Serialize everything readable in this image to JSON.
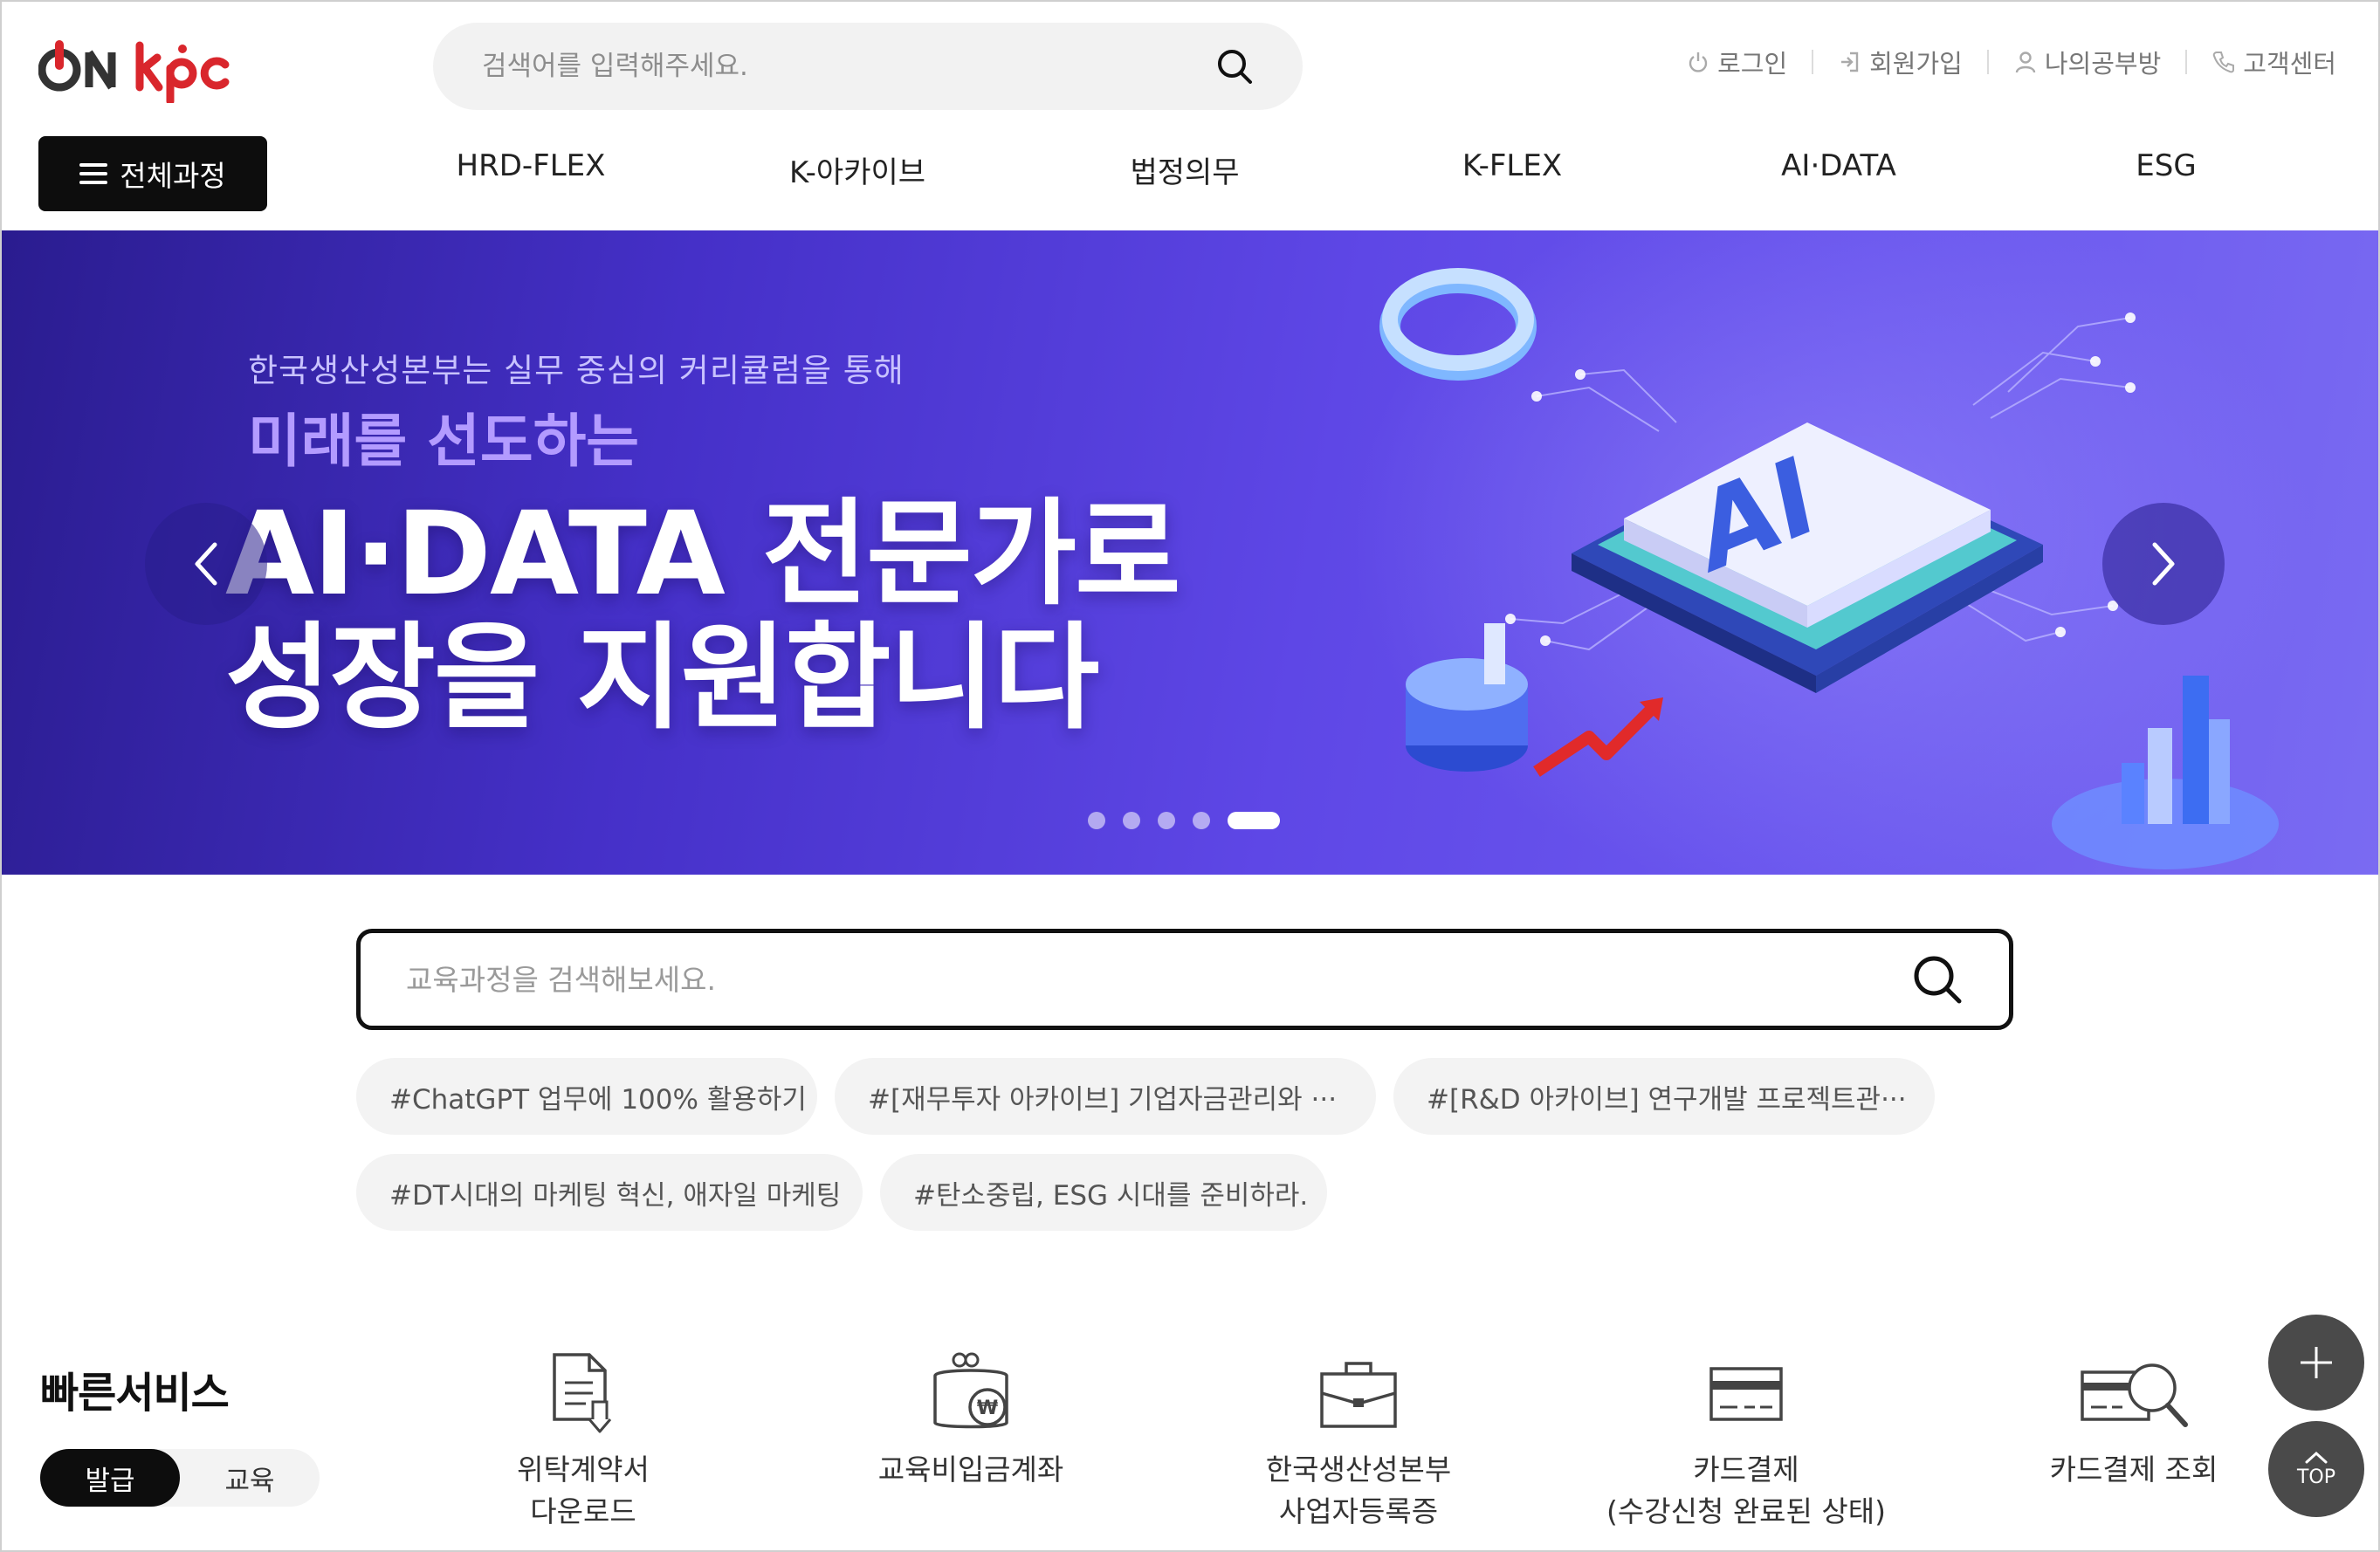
{
  "logo": {
    "alt": "ON kpc"
  },
  "header": {
    "search_placeholder": "검색어를 입력해주세요.",
    "util": [
      {
        "label": "로그인",
        "icon": "power-icon"
      },
      {
        "label": "회원가입",
        "icon": "signin-icon"
      },
      {
        "label": "나의공부방",
        "icon": "user-icon"
      },
      {
        "label": "고객센터",
        "icon": "phone-icon"
      }
    ]
  },
  "nav": {
    "all_courses": "전체과정",
    "items": [
      "HRD-FLEX",
      "K-아카이브",
      "법정의무",
      "K-FLEX",
      "AI·DATA",
      "ESG"
    ]
  },
  "banner": {
    "subtitle": "한국생산성본부는 실무 중심의 커리큘럼을 통해",
    "headline_small": "미래를 선도하는",
    "headline_line1": "AI·DATA 전문가로",
    "headline_line2": "성장을 지원합니다",
    "slide_count": 5,
    "active_slide": 5,
    "chip_text": "AI"
  },
  "main_search": {
    "placeholder": "교육과정을 검색해보세요."
  },
  "tags": [
    "#ChatGPT 업무에 100% 활용하기",
    "#[재무투자 아카이브] 기업자금관리와 ···",
    "#[R&D 아카이브] 연구개발 프로젝트관···",
    "#DT시대의 마케팅 혁신, 애자일 마케팅",
    "#탄소중립, ESG 시대를 준비하라."
  ],
  "quick_service": {
    "title": "빠른서비스",
    "toggle": [
      "발급",
      "교육"
    ],
    "items": [
      {
        "label": "위탁계약서\n다운로드",
        "icon": "document-download-icon"
      },
      {
        "label": "교육비입금계좌",
        "icon": "wallet-won-icon"
      },
      {
        "label": "한국생산성본부\n사업자등록증",
        "icon": "briefcase-icon"
      },
      {
        "label": "카드결제\n(수강신청 완료된 상태)",
        "icon": "credit-card-icon"
      },
      {
        "label": "카드결제 조회",
        "icon": "card-search-icon"
      }
    ]
  },
  "floating": {
    "top_label": "TOP"
  },
  "colors": {
    "brand_red": "#d9262c",
    "banner_purple": "#5e47e6",
    "black": "#0d0d0d"
  }
}
